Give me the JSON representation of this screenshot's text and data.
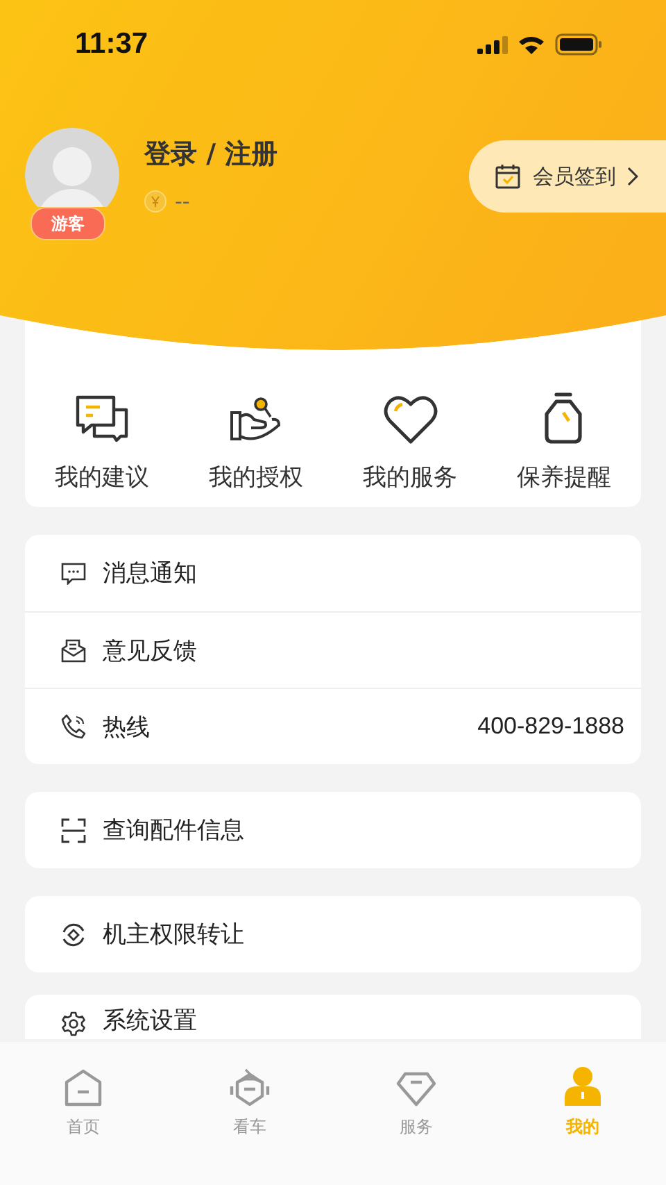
{
  "status_bar": {
    "time": "11:37"
  },
  "profile": {
    "badge": "游客",
    "login": "登录 / 注册",
    "points": "--",
    "checkin": "会员签到"
  },
  "quick_actions": [
    {
      "label": "我的建议"
    },
    {
      "label": "我的授权"
    },
    {
      "label": "我的服务"
    },
    {
      "label": "保养提醒"
    }
  ],
  "menu_groups": [
    [
      {
        "label": "消息通知"
      },
      {
        "label": "意见反馈"
      },
      {
        "label": "热线",
        "value": "400-829-1888"
      }
    ],
    [
      {
        "label": "查询配件信息"
      }
    ],
    [
      {
        "label": "机主权限转让"
      }
    ],
    [
      {
        "label": "系统设置"
      }
    ]
  ],
  "tab_bar": [
    {
      "label": "首页",
      "selected": false
    },
    {
      "label": "看车",
      "selected": false
    },
    {
      "label": "服务",
      "selected": false
    },
    {
      "label": "我的",
      "selected": true
    }
  ]
}
